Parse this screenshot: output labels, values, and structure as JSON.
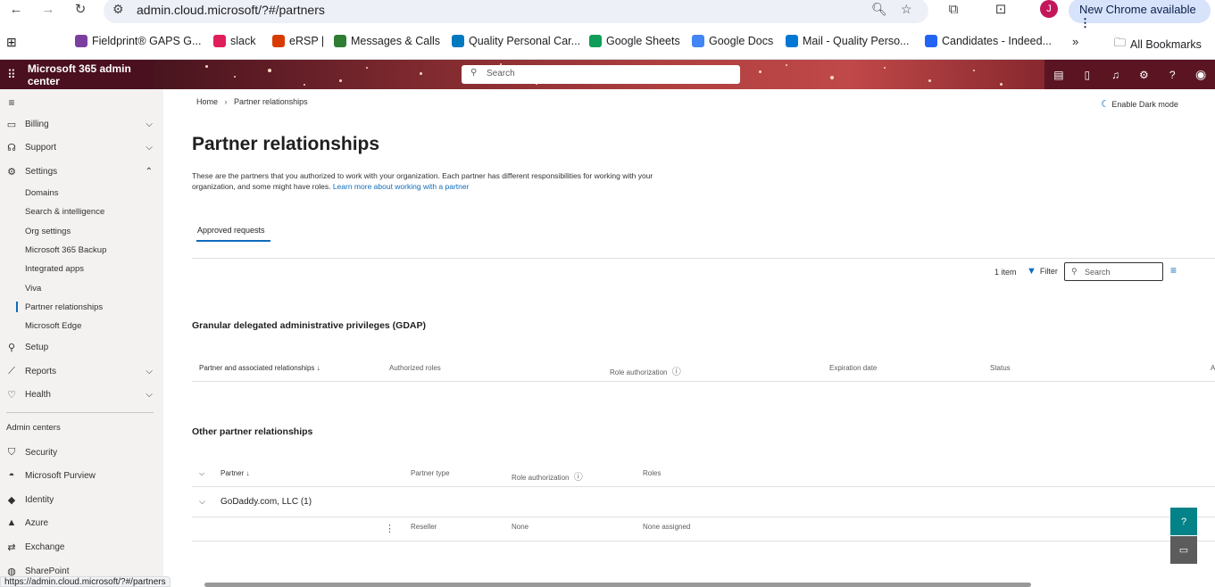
{
  "browser": {
    "url": "admin.cloud.microsoft/?#/partners",
    "new_chrome": "New Chrome available",
    "avatar_initial": "J",
    "status_url": "https://admin.cloud.microsoft/?#/partners"
  },
  "bookmarks": [
    {
      "label": "Fieldprint® GAPS G...",
      "icon": "fieldprint-icon",
      "color": "#7b3fa0"
    },
    {
      "label": "slack",
      "icon": "slack-icon",
      "color": "#e01e5a"
    },
    {
      "label": "eRSP |",
      "icon": "ersp-icon",
      "color": "#d83b01"
    },
    {
      "label": "Messages & Calls",
      "icon": "messages-icon",
      "color": "#2e7d32"
    },
    {
      "label": "Quality Personal Car...",
      "icon": "trello-icon",
      "color": "#0079bf"
    },
    {
      "label": "Google Sheets",
      "icon": "sheets-icon",
      "color": "#0f9d58"
    },
    {
      "label": "Google Docs",
      "icon": "docs-icon",
      "color": "#4285f4"
    },
    {
      "label": "Mail - Quality Perso...",
      "icon": "outlook-icon",
      "color": "#0078d4"
    },
    {
      "label": "Candidates - Indeed...",
      "icon": "indeed-icon",
      "color": "#2164f3"
    }
  ],
  "all_bookmarks": "All Bookmarks",
  "app": {
    "brand": "Microsoft 365 admin center",
    "search_placeholder": "Search"
  },
  "sidebar": {
    "items": [
      {
        "label": "Billing",
        "icon": "billing-icon",
        "expand": "collapsed"
      },
      {
        "label": "Support",
        "icon": "support-icon",
        "expand": "collapsed"
      },
      {
        "label": "Settings",
        "icon": "settings-icon",
        "expand": "expanded"
      }
    ],
    "settings_sub": [
      "Domains",
      "Search & intelligence",
      "Org settings",
      "Microsoft 365 Backup",
      "Integrated apps",
      "Viva",
      "Partner relationships",
      "Microsoft Edge"
    ],
    "active_sub": "Partner relationships",
    "items2": [
      {
        "label": "Setup",
        "icon": "setup-icon"
      },
      {
        "label": "Reports",
        "icon": "reports-icon",
        "expand": "collapsed"
      },
      {
        "label": "Health",
        "icon": "health-icon",
        "expand": "collapsed"
      }
    ],
    "admin_centers_heading": "Admin centers",
    "admin_centers": [
      {
        "label": "Security",
        "icon": "shield-icon"
      },
      {
        "label": "Microsoft Purview",
        "icon": "purview-icon"
      },
      {
        "label": "Identity",
        "icon": "identity-icon"
      },
      {
        "label": "Azure",
        "icon": "azure-icon"
      },
      {
        "label": "Exchange",
        "icon": "exchange-icon"
      },
      {
        "label": "SharePoint",
        "icon": "sharepoint-icon"
      }
    ]
  },
  "main": {
    "breadcrumb_home": "Home",
    "breadcrumb_current": "Partner relationships",
    "dark_mode": "Enable Dark mode",
    "title": "Partner relationships",
    "description": "These are the partners that you authorized to work with your organization. Each partner has different responsibilities for working with your organization, and some might have roles.",
    "learn_more": "Learn more about working with a partner",
    "tab": "Approved requests",
    "item_count": "1 item",
    "filter": "Filter",
    "search_placeholder": "Search",
    "gdap": {
      "title": "Granular delegated administrative privileges (GDAP)",
      "columns": [
        "Partner and associated relationships ↓",
        "Authorized roles",
        "Role authorization",
        "Expiration date",
        "Status",
        "A"
      ]
    },
    "other": {
      "title": "Other partner relationships",
      "columns": [
        "Partner ↓",
        "Partner type",
        "Role authorization",
        "Roles"
      ],
      "group": "GoDaddy.com, LLC (1)",
      "row": {
        "type": "Reseller",
        "role_auth": "None",
        "roles": "None assigned"
      }
    }
  },
  "colors": {
    "accent": "#0f6cbd",
    "fab_teal": "#038387",
    "fab_gray": "#5c5c5c"
  }
}
